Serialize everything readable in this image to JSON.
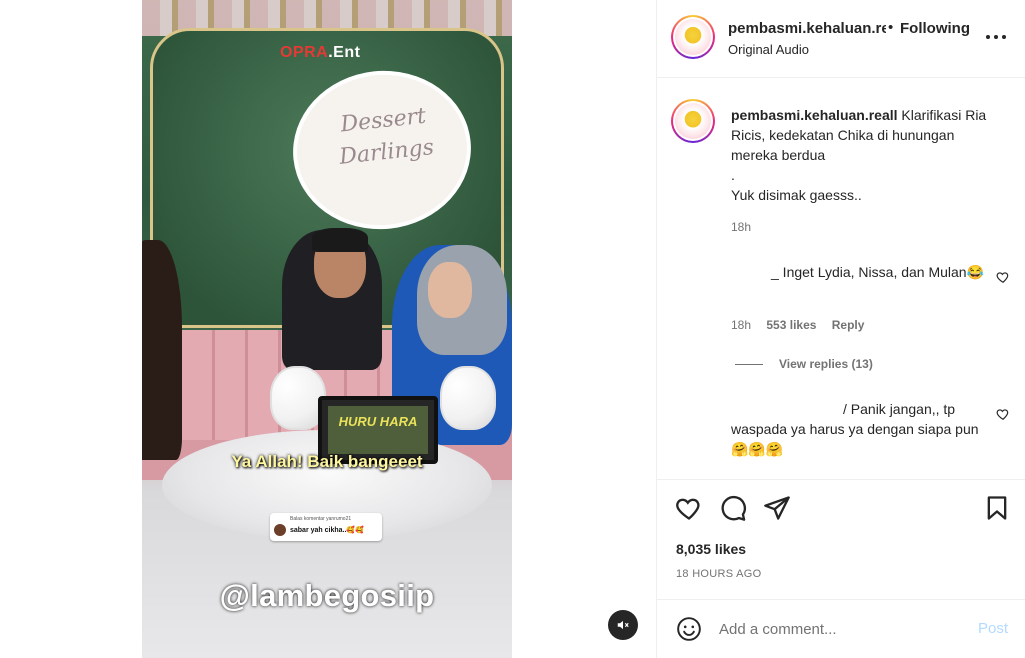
{
  "video": {
    "brand_red": "OPRA",
    "brand_white": ".Ent",
    "sign_line1": "Dessert",
    "sign_line2": "Darlings",
    "tablet_text": "HURU HARA",
    "subtitle": "Ya Allah! Baik bangeeet",
    "sticker_small": "Balas komentar yanrumo21",
    "sticker_main": "sabar yah cikha..🥰🥰",
    "watermark": "@lambegosiip",
    "mute_icon": "speaker-muted-icon"
  },
  "header": {
    "username": "pembasmi.kehaluan.re",
    "dot": "•",
    "follow_status": "Following",
    "audio": "Original Audio",
    "more_icon": "more-horizontal-icon"
  },
  "caption": {
    "username": "pembasmi.kehaluan.reall",
    "text_line1": " Klarifikasi Ria Ricis, kedekatan Chika di hunungan mereka berdua",
    "text_line2": ".",
    "text_line3": "Yuk disimak gaesss..",
    "time": "18h"
  },
  "comments": [
    {
      "text": "_ Inget Lydia, Nissa, dan Mulan",
      "emoji": "😂",
      "time": "18h",
      "likes": "553 likes",
      "reply": "Reply",
      "view_replies": "View replies (13)"
    },
    {
      "text": "/ Panik jangan,, tp waspada ya harus ya dengan siapa pun",
      "emoji": "🤗🤗🤗"
    }
  ],
  "actions": {
    "like_icon": "heart-icon",
    "comment_icon": "comment-icon",
    "share_icon": "send-icon",
    "save_icon": "bookmark-icon",
    "likes": "8,035 likes",
    "timestamp": "18 HOURS AGO"
  },
  "add_comment": {
    "placeholder": "Add a comment...",
    "post_label": "Post",
    "emoji_icon": "smiley-icon"
  },
  "colors": {
    "text": "#262626",
    "secondary": "#737373",
    "post_disabled": "#b3dbff",
    "divider": "#efefef"
  }
}
